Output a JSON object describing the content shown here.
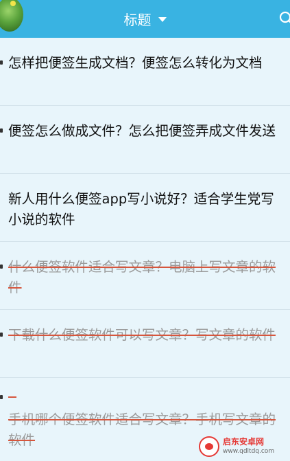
{
  "header": {
    "title": "标题"
  },
  "notes": [
    {
      "text": "怎样把便签生成文档？便签怎么转化为文档",
      "completed": false
    },
    {
      "text": "便签怎么做成文件？怎么把便签弄成文件发送",
      "completed": false
    },
    {
      "text": "新人用什么便签app写小说好？适合学生党写小说的软件",
      "completed": false
    },
    {
      "text": "什么便签软件适合写文章？电脑上写文章的软件",
      "completed": true
    },
    {
      "text": "下载什么便签软件可以写文章？写文章的软件",
      "completed": true
    },
    {
      "text": "手机哪个便签软件适合写文章？手机写文章的软件",
      "completed": true
    }
  ],
  "watermark": {
    "name": "启东安卓网",
    "url": "www.qdltdq.com"
  },
  "colors": {
    "accent": "#39b3e2",
    "strike": "#d6563d",
    "background": "#e8f5fb"
  }
}
